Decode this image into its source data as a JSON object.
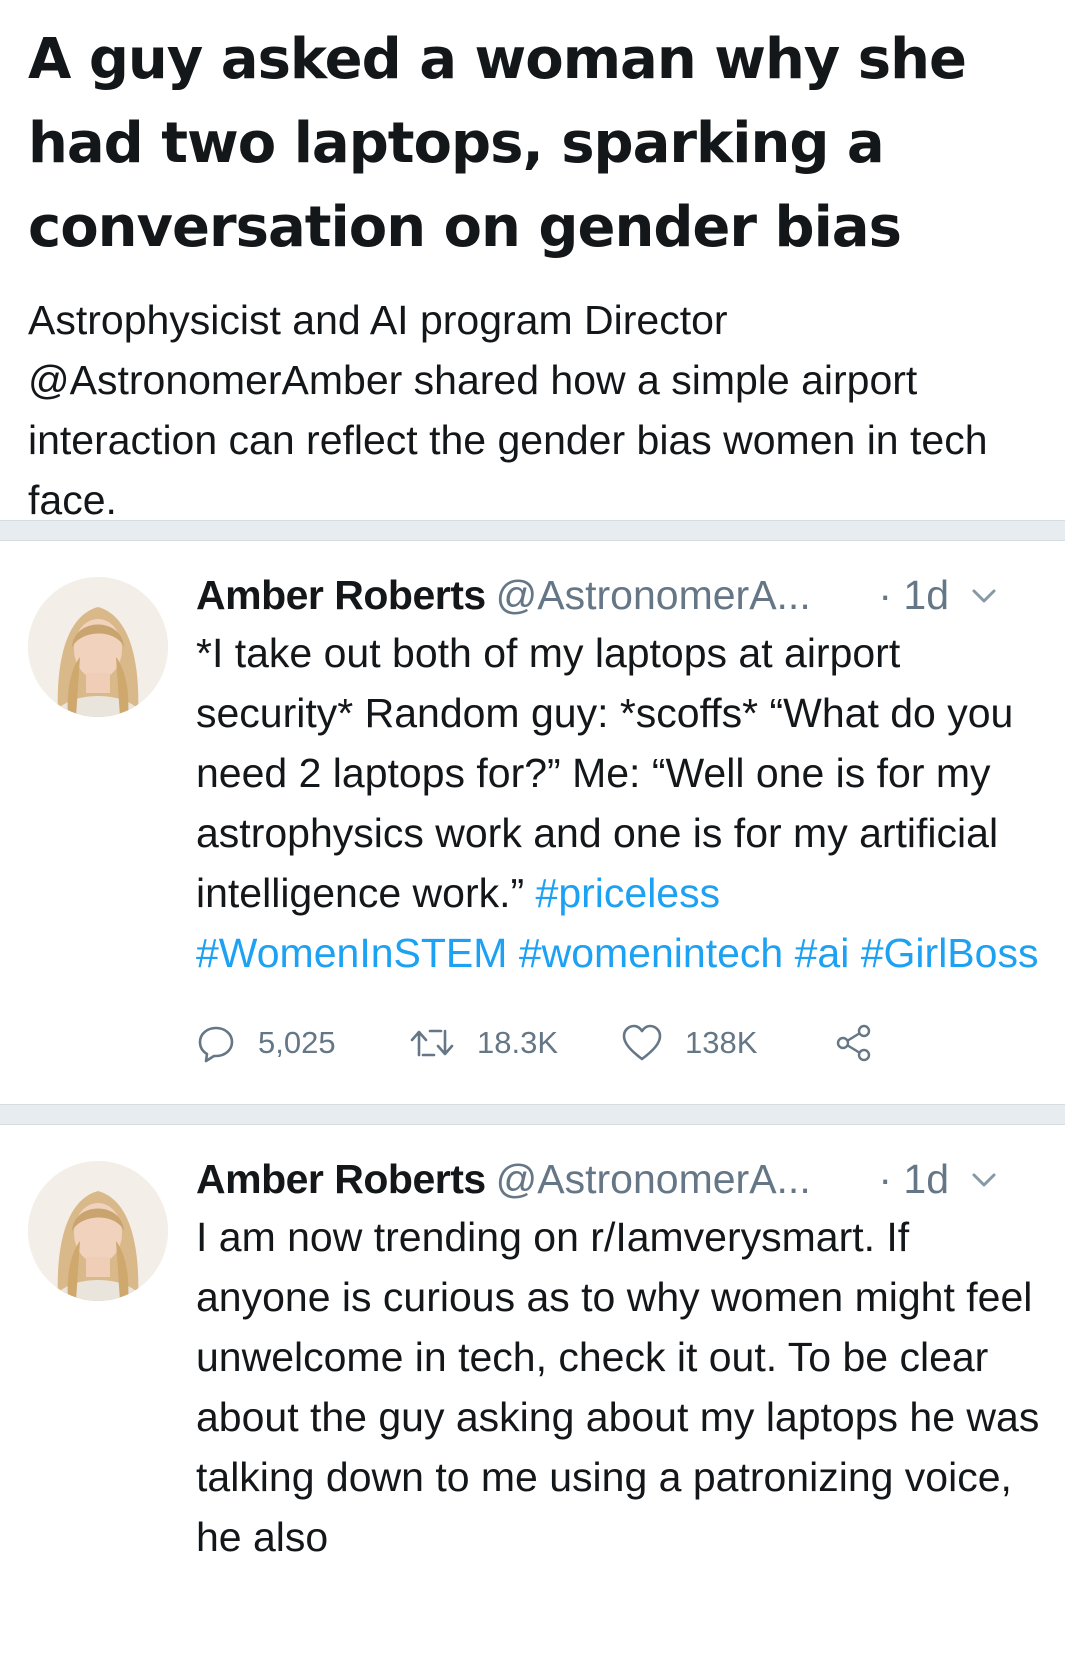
{
  "article": {
    "headline": "A guy asked a woman why she had two laptops, sparking a conversation on gender bias",
    "summary": "Astrophysicist and AI program Director @AstronomerAmber shared how a simple airport interaction can reflect the gender bias women in tech face."
  },
  "tweets": [
    {
      "name": "Amber Roberts",
      "handle": "@AstronomerA...",
      "time": "· 1d",
      "text": "*I take out both of my laptops at airport security* Random guy: *scoffs* “What do you need 2 laptops for?” Me: “Well one is for my astrophysics work and one is for my artificial intelligence work.” ",
      "hashtags": [
        "#priceless",
        "#WomenInSTEM",
        "#womenintech",
        "#ai",
        "#GirlBoss"
      ],
      "replies": "5,025",
      "retweets": "18.3K",
      "likes": "138K"
    },
    {
      "name": "Amber Roberts",
      "handle": "@AstronomerA...",
      "time": "· 1d",
      "text": "I am now trending on r/Iamverysmart. If anyone is curious as to why women might feel unwelcome in tech, check it out. To be clear about the guy asking about my laptops he was talking down to me using a patronizing voice, he also"
    }
  ],
  "colors": {
    "text": "#14171a",
    "secondary": "#657786",
    "link": "#1da1f2",
    "divider": "#e6ecf0"
  },
  "icons": [
    "reply-icon",
    "retweet-icon",
    "like-icon",
    "share-icon",
    "chevron-down-icon"
  ]
}
